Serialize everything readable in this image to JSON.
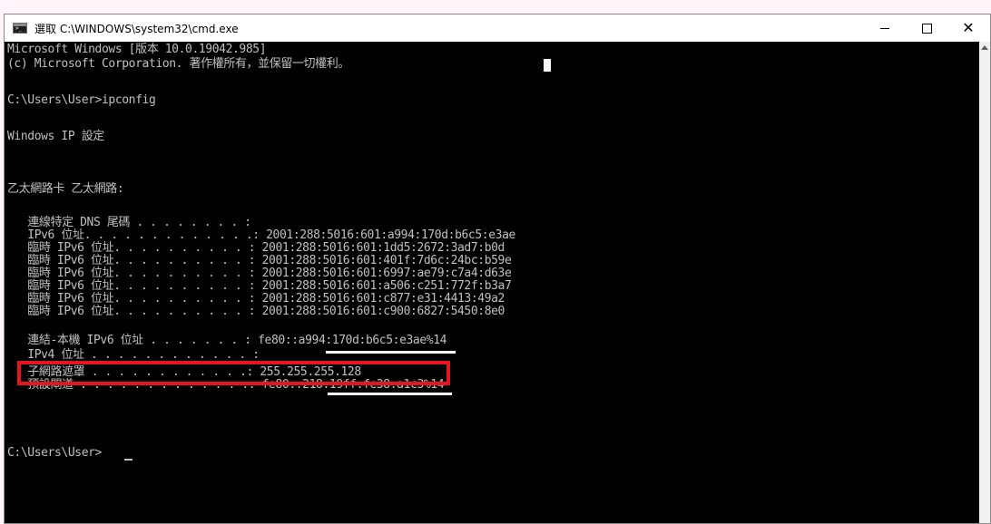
{
  "window": {
    "title": "選取 C:\\WINDOWS\\system32\\cmd.exe",
    "icon": "terminal-icon",
    "buttons": {
      "minimize": "—",
      "maximize": "☐",
      "close": "✕"
    }
  },
  "console": {
    "lines": [
      "Microsoft Windows [版本 10.0.19042.985]",
      "(c) Microsoft Corporation. 著作權所有，並保留一切權利。",
      "C:\\Users\\User>ipconfig",
      "Windows IP 設定",
      "乙太網路卡 乙太網路:",
      "   連線特定 DNS 尾碼 . . . . . . . . :",
      "   IPv6 位址. . . . . . . . . . . . .: 2001:288:5016:601:a994:170d:b6c5:e3ae",
      "   臨時 IPv6 位址. . . . . . . . . . : 2001:288:5016:601:1dd5:2672:3ad7:b0d",
      "   臨時 IPv6 位址. . . . . . . . . . : 2001:288:5016:601:401f:7d6c:24bc:b59e",
      "   臨時 IPv6 位址. . . . . . . . . . : 2001:288:5016:601:6997:ae79:c7a4:d63e",
      "   臨時 IPv6 位址. . . . . . . . . . : 2001:288:5016:601:a506:c251:772f:b3a7",
      "   臨時 IPv6 位址. . . . . . . . . . : 2001:288:5016:601:c877:e31:4413:49a2",
      "   臨時 IPv6 位址. . . . . . . . . . : 2001:288:5016:601:c900:6827:5450:8e0",
      "   連結-本機 IPv6 位址 . . . . . . . : fe80::a994:170d:b6c5:e3ae%14",
      "   IPv4 位址 . . . . . . . . . . . . :",
      "   子網路遮罩 . . . . . . . . . . . .: 255.255.255.128",
      "   預設閘道 . . . . . . . . . . . . .: fe80::218:19ff:fe38:a1c3%14",
      "C:\\Users\\User>"
    ]
  },
  "colors": {
    "console_bg": "#000000",
    "console_text": "#c0c0c0",
    "highlight": "#e8141e"
  }
}
